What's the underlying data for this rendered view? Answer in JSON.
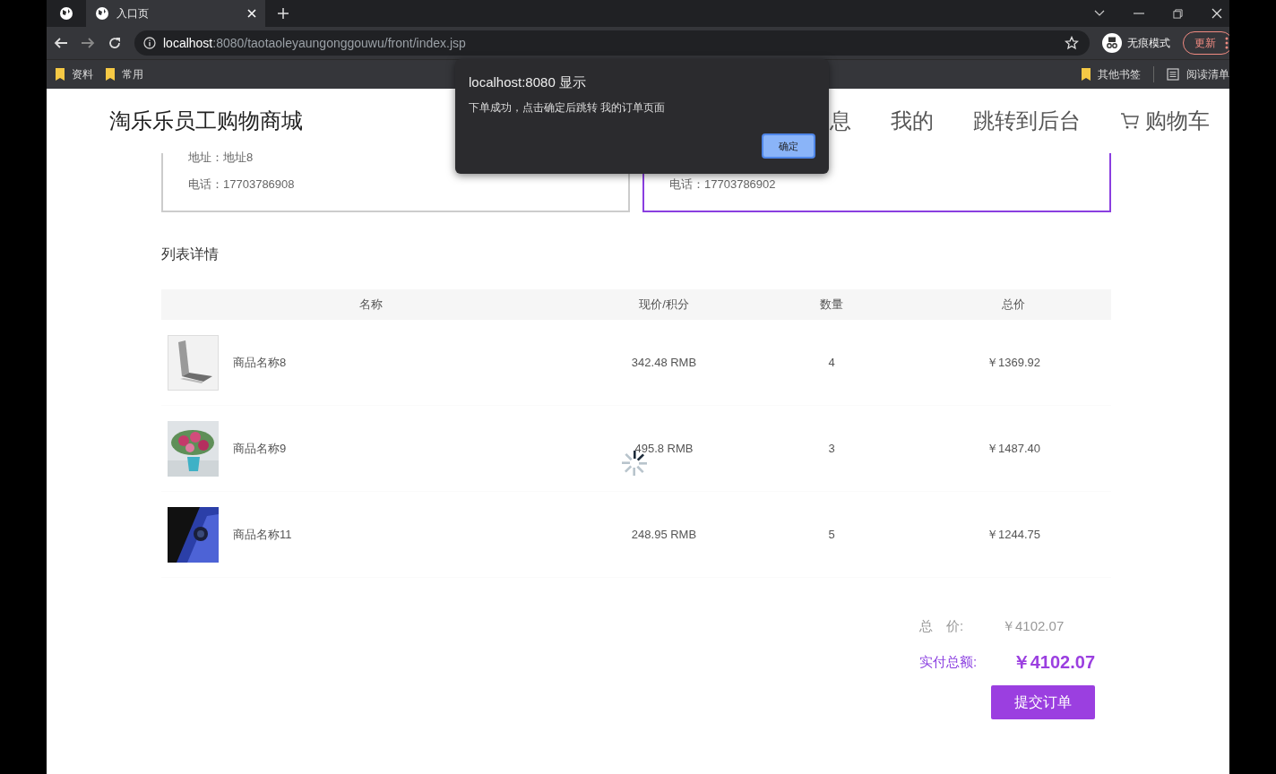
{
  "browser": {
    "tabs": [
      {
        "title": "入口页",
        "selected": true
      }
    ],
    "url_host": "localhost",
    "url_rest": ":8080/taotaoleyaungonggouwu/front/index.jsp",
    "profile": "无痕模式",
    "update_button": "更新",
    "bookmarks_left": [
      "资料",
      "常用"
    ],
    "bookmarks_right": [
      "其他书签",
      "阅读清单"
    ]
  },
  "header": {
    "logo": "淘乐乐员工购物商城",
    "nav": [
      {
        "label": "息",
        "kind": "text"
      },
      {
        "label": "我的",
        "kind": "text"
      },
      {
        "label": "跳转到后台",
        "kind": "text"
      },
      {
        "label": "购物车",
        "kind": "cart"
      }
    ]
  },
  "addresses": [
    {
      "selected": false,
      "lines": [
        "地址：地址8",
        "电话：17703786908"
      ]
    },
    {
      "selected": true,
      "lines": [
        "电话：17703786902"
      ]
    }
  ],
  "section_title": "列表详情",
  "table": {
    "columns": [
      "名称",
      "现价/积分",
      "数量",
      "总价"
    ],
    "rows": [
      {
        "kind": "laptop",
        "name": "商品名称8",
        "price": "342.48 RMB",
        "qty": "4",
        "total": "￥1369.92"
      },
      {
        "kind": "flowers",
        "name": "商品名称9",
        "price": "495.8 RMB",
        "qty": "3",
        "total": "￥1487.40"
      },
      {
        "kind": "phone",
        "name": "商品名称11",
        "price": "248.95 RMB",
        "qty": "5",
        "total": "￥1244.75"
      }
    ]
  },
  "summary": {
    "total_label": "总　价:",
    "total": "￥4102.07",
    "paid_label": "实付总额:",
    "paid": "￥4102.07",
    "submit": "提交订单"
  },
  "dialog": {
    "title": "localhost:8080 显示",
    "message": "下单成功，点击确定后跳转 我的订单页面",
    "ok": "确定"
  }
}
